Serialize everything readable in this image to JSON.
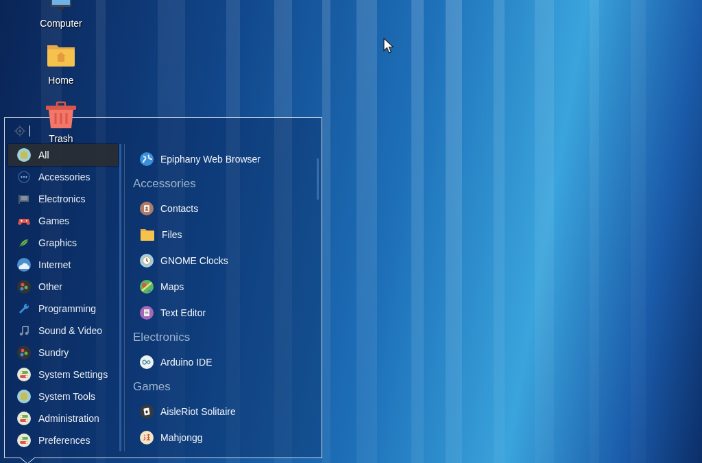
{
  "desktop_icons": [
    {
      "label": "Computer"
    },
    {
      "label": "Home"
    },
    {
      "label": "Trash"
    }
  ],
  "menu": {
    "categories": [
      {
        "label": "All",
        "selected": true
      },
      {
        "label": "Accessories",
        "selected": false
      },
      {
        "label": "Electronics",
        "selected": false
      },
      {
        "label": "Games",
        "selected": false
      },
      {
        "label": "Graphics",
        "selected": false
      },
      {
        "label": "Internet",
        "selected": false
      },
      {
        "label": "Other",
        "selected": false
      },
      {
        "label": "Programming",
        "selected": false
      },
      {
        "label": "Sound & Video",
        "selected": false
      },
      {
        "label": "Sundry",
        "selected": false
      },
      {
        "label": "System Settings",
        "selected": false
      },
      {
        "label": "System Tools",
        "selected": false
      },
      {
        "label": "Administration",
        "selected": false
      },
      {
        "label": "Preferences",
        "selected": false
      }
    ],
    "entries": [
      {
        "kind": "app",
        "label": "Epiphany Web Browser"
      },
      {
        "kind": "header",
        "label": "Accessories"
      },
      {
        "kind": "app",
        "label": "Contacts"
      },
      {
        "kind": "app",
        "label": "Files"
      },
      {
        "kind": "app",
        "label": "GNOME Clocks"
      },
      {
        "kind": "app",
        "label": "Maps"
      },
      {
        "kind": "app",
        "label": "Text Editor"
      },
      {
        "kind": "header",
        "label": "Electronics"
      },
      {
        "kind": "app",
        "label": "Arduino IDE"
      },
      {
        "kind": "header",
        "label": "Games"
      },
      {
        "kind": "app",
        "label": "AisleRiot Solitaire"
      },
      {
        "kind": "app",
        "label": "Mahjongg"
      }
    ]
  }
}
